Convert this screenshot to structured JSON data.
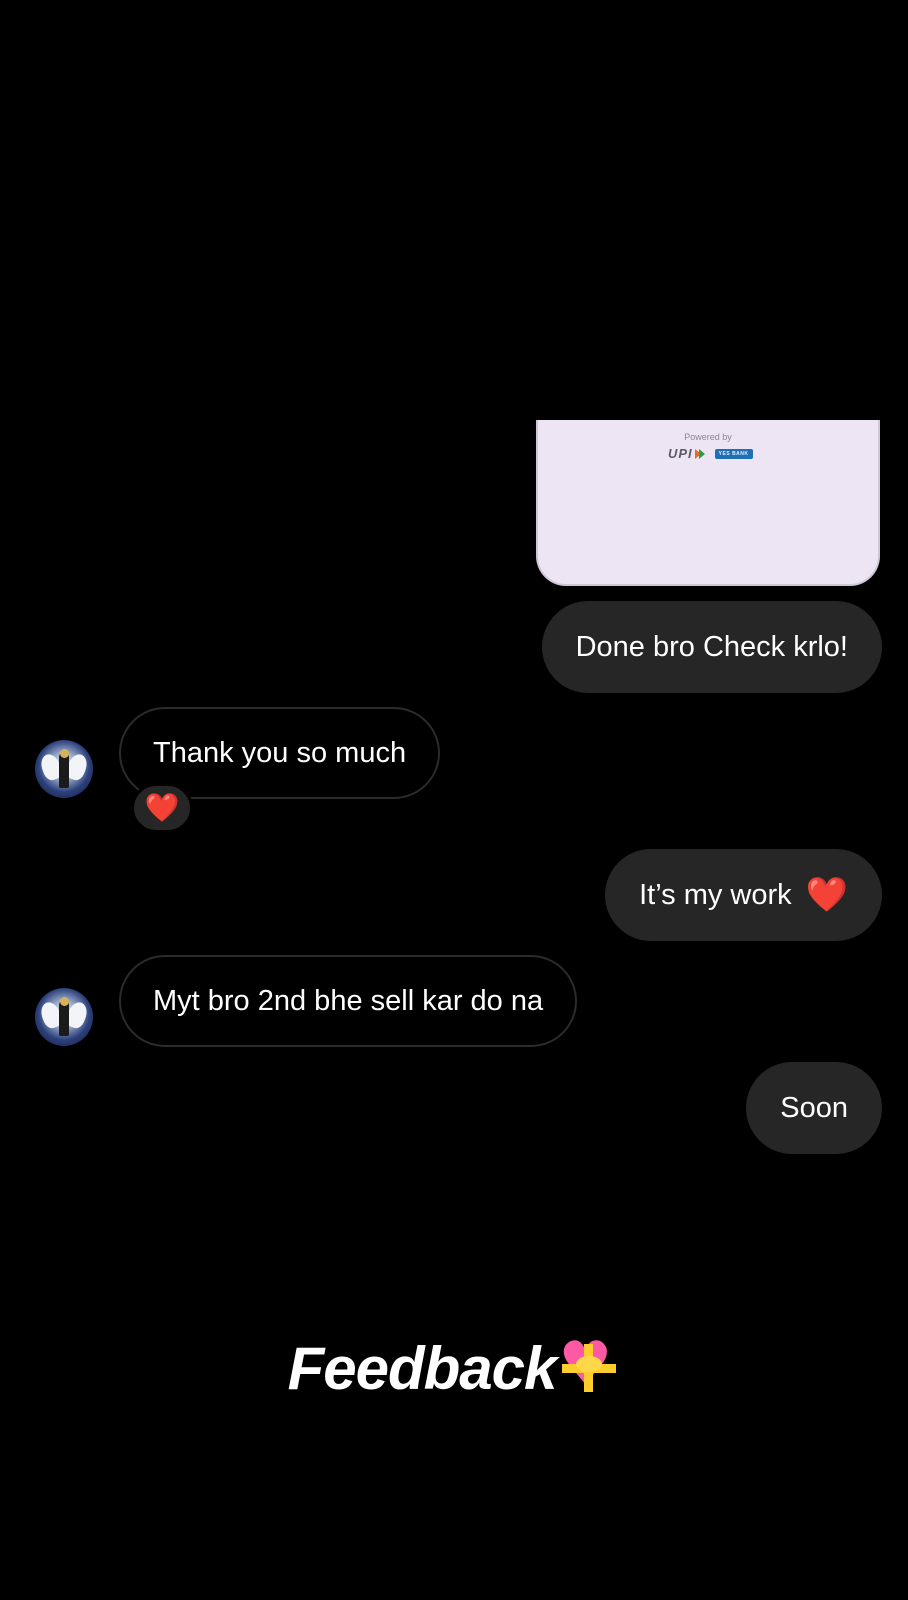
{
  "payment_card": {
    "powered_by": "Powered by",
    "upi_label": "UPI",
    "bank_label": "YES BANK"
  },
  "messages": [
    {
      "id": "m1",
      "side": "sent",
      "text": "Done bro Check krlo!"
    },
    {
      "id": "m2",
      "side": "received",
      "text": "Thank you so much",
      "reaction": "❤️"
    },
    {
      "id": "m3",
      "side": "sent",
      "text": "It’s my work",
      "emoji": "❤️"
    },
    {
      "id": "m4",
      "side": "received",
      "text": "Myt bro 2nd bhe sell kar do na"
    },
    {
      "id": "m5",
      "side": "sent",
      "text": "Soon"
    }
  ],
  "footer": {
    "text": "Feedback",
    "icon": "heart-with-ribbon-icon"
  },
  "colors": {
    "background": "#000000",
    "sent_bubble": "#262626",
    "received_border": "#2b2b2b",
    "heart": "#ff1f3c",
    "card_background": "#ede5f3"
  }
}
